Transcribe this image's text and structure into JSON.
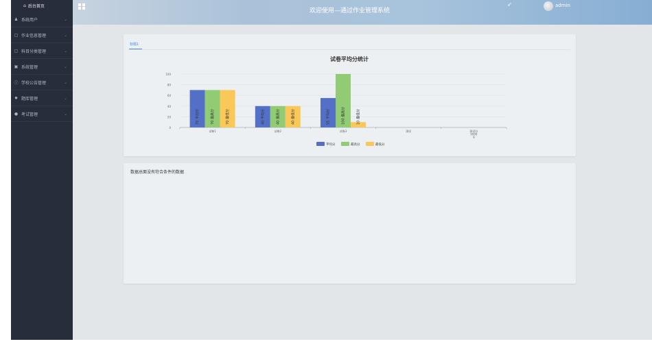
{
  "sidebar": {
    "home_label": "后台首页",
    "items": [
      {
        "label": "系统用户",
        "icon": "user-icon"
      },
      {
        "label": "作业信息管理",
        "icon": "document-icon"
      },
      {
        "label": "科目分类管理",
        "icon": "folder-icon"
      },
      {
        "label": "系统管理",
        "icon": "image-icon"
      },
      {
        "label": "学校公告管理",
        "icon": "info-icon"
      },
      {
        "label": "题库管理",
        "icon": "gear-icon"
      },
      {
        "label": "考试管理",
        "icon": "pin-icon"
      }
    ]
  },
  "header": {
    "title": "欢迎使用—通过作业管理系统",
    "user": "admin"
  },
  "tabs": [
    {
      "label": "标题1"
    }
  ],
  "chart_data": {
    "type": "bar",
    "title": "试卷平均分统计",
    "categories": [
      "试卷1",
      "试卷2",
      "试卷3",
      "测试",
      "测试分 9999 9"
    ],
    "series": [
      {
        "name": "平均分",
        "color": "#5470c6",
        "values": [
          70,
          40,
          55,
          null,
          null
        ],
        "labels": [
          "70 平均分",
          "40 平均分",
          "55 平均分"
        ]
      },
      {
        "name": "最高分",
        "color": "#91cc75",
        "values": [
          70,
          40,
          100,
          null,
          null
        ],
        "labels": [
          "70 最高分",
          "40 最高分",
          "100 最高分"
        ]
      },
      {
        "name": "最低分",
        "color": "#fac858",
        "values": [
          70,
          40,
          10,
          null,
          null
        ],
        "labels": [
          "70 最低分",
          "40 最低分",
          "10 最低分"
        ]
      }
    ],
    "yticks": [
      0,
      20,
      40,
      60,
      80,
      100
    ],
    "ylim": [
      0,
      100
    ],
    "legend_position": "bottom",
    "grid": true
  },
  "empty_message": "数据总面没有符合条件的数据"
}
